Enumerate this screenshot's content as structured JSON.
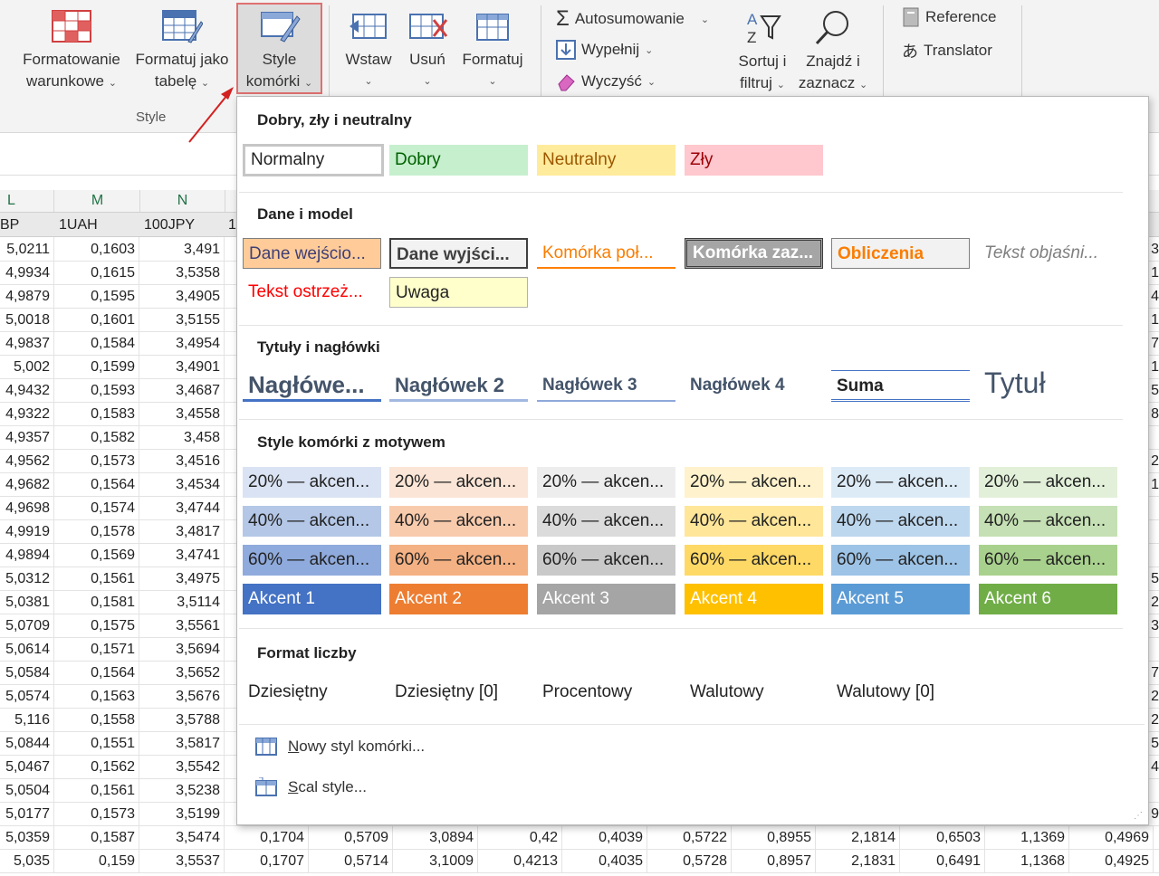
{
  "ribbon": {
    "buttons": [
      {
        "id": "cond",
        "l1": "Formatowanie",
        "l2": "warunkowe"
      },
      {
        "id": "table",
        "l1": "Formatuj jako",
        "l2": "tabelę"
      },
      {
        "id": "style",
        "l1": "Style",
        "l2": "komórki"
      },
      {
        "id": "insert",
        "l1": "Wstaw"
      },
      {
        "id": "delete",
        "l1": "Usuń"
      },
      {
        "id": "format",
        "l1": "Formatuj"
      },
      {
        "id": "sort",
        "l1": "Sortuj i",
        "l2": "filtruj"
      },
      {
        "id": "find",
        "l1": "Znajdź i",
        "l2": "zaznacz"
      }
    ],
    "autosum": "Autosumowanie",
    "fill": "Wypełnij",
    "clear": "Wyczyść",
    "reference": "Reference",
    "translator": "Translator",
    "group_label": "Style"
  },
  "sheet": {
    "col_letters": [
      "L",
      "M",
      "N"
    ],
    "headers": [
      "BP",
      "1UAH",
      "100JPY",
      "1"
    ],
    "rows": [
      [
        "5,0211",
        "0,1603",
        "3,491"
      ],
      [
        "4,9934",
        "0,1615",
        "3,5358"
      ],
      [
        "4,9879",
        "0,1595",
        "3,4905"
      ],
      [
        "5,0018",
        "0,1601",
        "3,5155"
      ],
      [
        "4,9837",
        "0,1584",
        "3,4954"
      ],
      [
        "5,002",
        "0,1599",
        "3,4901"
      ],
      [
        "4,9432",
        "0,1593",
        "3,4687"
      ],
      [
        "4,9322",
        "0,1583",
        "3,4558"
      ],
      [
        "4,9357",
        "0,1582",
        "3,458"
      ],
      [
        "4,9562",
        "0,1573",
        "3,4516"
      ],
      [
        "4,9682",
        "0,1564",
        "3,4534"
      ],
      [
        "4,9698",
        "0,1574",
        "3,4744"
      ],
      [
        "4,9919",
        "0,1578",
        "3,4817"
      ],
      [
        "4,9894",
        "0,1569",
        "3,4741"
      ],
      [
        "5,0312",
        "0,1561",
        "3,4975"
      ],
      [
        "5,0381",
        "0,1581",
        "3,5114"
      ],
      [
        "5,0709",
        "0,1575",
        "3,5561"
      ],
      [
        "5,0614",
        "0,1571",
        "3,5694"
      ],
      [
        "5,0584",
        "0,1564",
        "3,5652"
      ],
      [
        "5,0574",
        "0,1563",
        "3,5676"
      ],
      [
        "5,116",
        "0,1558",
        "3,5788"
      ],
      [
        "5,0844",
        "0,1551",
        "3,5817"
      ],
      [
        "5,0467",
        "0,1562",
        "3,5542"
      ],
      [
        "5,0504",
        "0,1561",
        "3,5238"
      ],
      [
        "5,0177",
        "0,1573",
        "3,5199"
      ],
      [
        "5,0359",
        "0,1587",
        "3,5474",
        "0,1704",
        "0,5709",
        "3,0894",
        "0,42",
        "0,4039",
        "0,5722",
        "0,8955",
        "2,1814",
        "0,6503",
        "1,1369",
        "0,4969"
      ],
      [
        "5,035",
        "0,159",
        "3,5537",
        "0,1707",
        "0,5714",
        "3,1009",
        "0,4213",
        "0,4035",
        "0,5728",
        "0,8957",
        "2,1831",
        "0,6491",
        "1,1368",
        "0,4925"
      ]
    ],
    "right_edge": [
      "3",
      "1",
      "4",
      "1",
      "7",
      "1",
      "5",
      "8",
      "",
      "2",
      "1",
      "",
      "",
      "",
      "5",
      "2",
      "3",
      "",
      "7",
      "2",
      "2",
      "5",
      "4",
      "",
      "9"
    ]
  },
  "dropdown": {
    "sec1": "Dobry, zły i neutralny",
    "good_bad": [
      "Normalny",
      "Dobry",
      "Neutralny",
      "Zły"
    ],
    "sec2": "Dane i model",
    "data_model": [
      "Dane wejścio...",
      "Dane wyjści...",
      "Komórka poł...",
      "Komórka zaz...",
      "Obliczenia",
      "Tekst objaśni...",
      "Tekst ostrzeż...",
      "Uwaga"
    ],
    "sec3": "Tytuły i nagłówki",
    "titles": [
      "Nagłówe...",
      "Nagłówek 2",
      "Nagłówek 3",
      "Nagłówek 4",
      "Suma",
      "Tytuł"
    ],
    "sec4": "Style komórki z motywem",
    "theme_rows": [
      [
        "20% — akcen...",
        "20% — akcen...",
        "20% — akcen...",
        "20% — akcen...",
        "20% — akcen...",
        "20% — akcen..."
      ],
      [
        "40% — akcen...",
        "40% — akcen...",
        "40% — akcen...",
        "40% — akcen...",
        "40% — akcen...",
        "40% — akcen..."
      ],
      [
        "60% — akcen...",
        "60% — akcen...",
        "60% — akcen...",
        "60% — akcen...",
        "60% — akcen...",
        "60% — akcen..."
      ],
      [
        "Akcent 1",
        "Akcent 2",
        "Akcent 3",
        "Akcent 4",
        "Akcent 5",
        "Akcent 6"
      ]
    ],
    "theme_colors": [
      [
        "#dae3f3",
        "#fbe5d6",
        "#ededed",
        "#fff2cc",
        "#ddebf7",
        "#e2f0d9"
      ],
      [
        "#b4c7e7",
        "#f8cbad",
        "#dbdbdb",
        "#ffe699",
        "#bdd7ee",
        "#c5e0b4"
      ],
      [
        "#8faadc",
        "#f4b183",
        "#c9c9c9",
        "#ffd966",
        "#9dc3e6",
        "#a9d18e"
      ],
      [
        "#4472c4",
        "#ed7d31",
        "#a5a5a5",
        "#ffc000",
        "#5b9bd5",
        "#70ad47"
      ]
    ],
    "sec5": "Format liczby",
    "number_formats": [
      "Dziesiętny",
      "Dziesiętny [0]",
      "Procentowy",
      "Walutowy",
      "Walutowy [0]"
    ],
    "cmd_new_u": "N",
    "cmd_new": "owy styl komórki...",
    "cmd_merge_u": "S",
    "cmd_merge": "cal style..."
  }
}
